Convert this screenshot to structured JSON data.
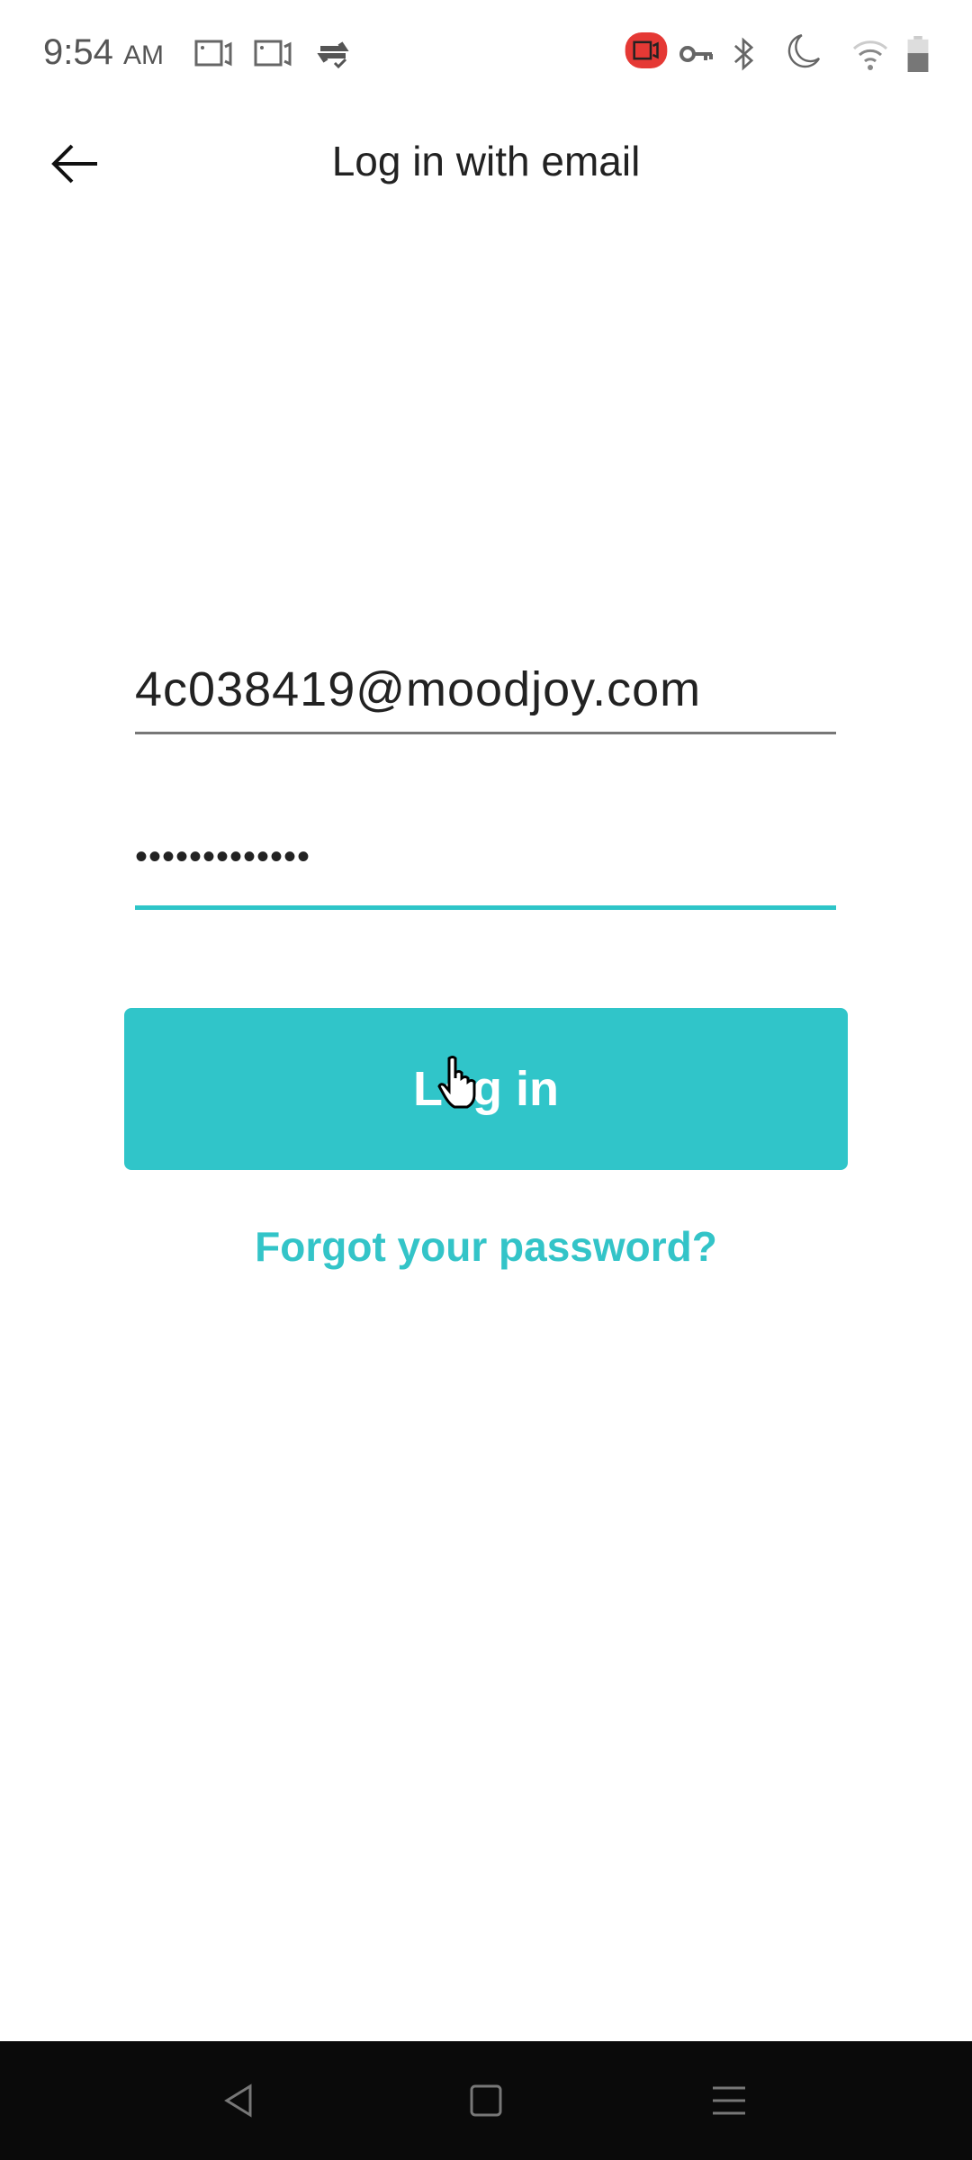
{
  "status_bar": {
    "time": "9:54",
    "ampm": "AM",
    "icons_left": [
      "screen-record-icon",
      "screen-record-icon",
      "sync-check-icon"
    ],
    "icons_right": [
      "recording-active-icon",
      "vpn-key-icon",
      "bluetooth-icon",
      "do-not-disturb-moon-icon",
      "wifi-icon",
      "battery-icon"
    ],
    "record_color": "#e53935"
  },
  "header": {
    "title": "Log in with email",
    "back_icon": "arrow-left-icon"
  },
  "form": {
    "email_value": "4c038419@moodjoy.com",
    "password_value": "•••••••••••••",
    "login_label": "Log in",
    "forgot_label": "Forgot your password?"
  },
  "colors": {
    "accent": "#30c5c9",
    "nav_bar": "#0a0a0a"
  },
  "nav_bar": {
    "icons": [
      "back-triangle-icon",
      "home-square-icon",
      "menu-lines-icon"
    ]
  }
}
